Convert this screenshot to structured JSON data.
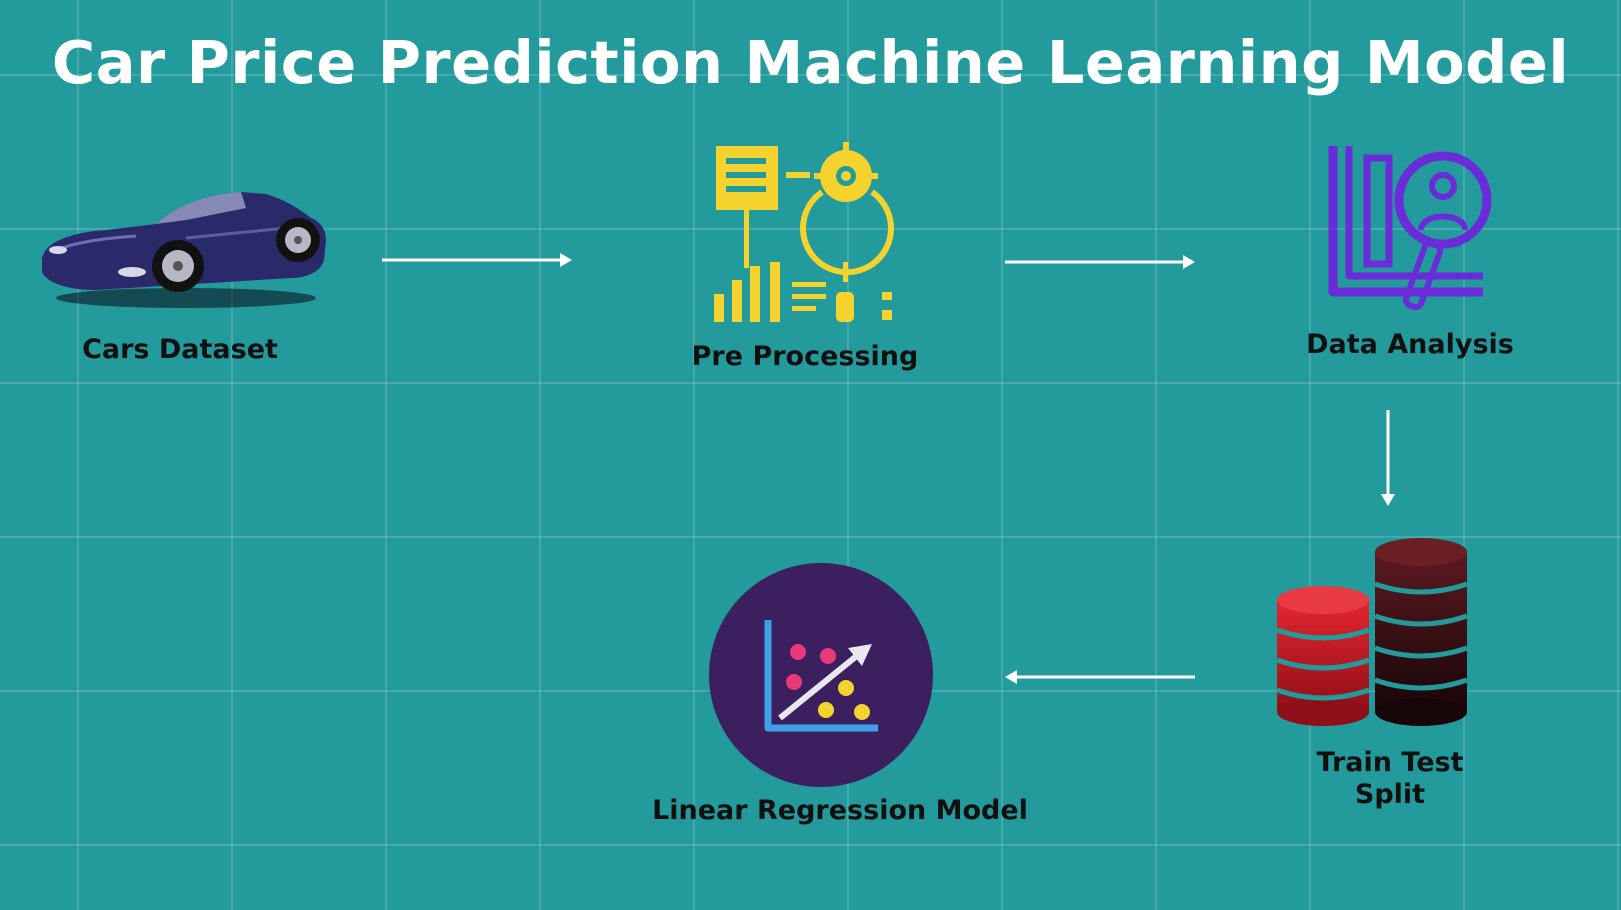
{
  "title": "Car Price Prediction Machine Learning Model",
  "nodes": {
    "cars_dataset": {
      "label": "Cars Dataset",
      "icon": "car-icon"
    },
    "pre_processing": {
      "label": "Pre Processing",
      "icon": "document-gear-icon"
    },
    "data_analysis": {
      "label": "Data Analysis",
      "icon": "analysis-magnifier-icon"
    },
    "train_test_split": {
      "label_line1": "Train Test",
      "label_line2": "Split",
      "icon": "database-stack-icon"
    },
    "linear_regression": {
      "label": "Linear Regression Model",
      "icon": "scatter-plot-icon"
    }
  },
  "colors": {
    "background": "#239a9c",
    "grid": "#ffffff",
    "title": "#ffffff",
    "label": "#101010",
    "car_body": "#2a2a6b",
    "pre_processing": "#f5d32e",
    "data_analysis": "#6a2bd9",
    "database_red": "#c8202a",
    "database_dark": "#3a1014",
    "regression_circle": "#3b1f5e"
  }
}
